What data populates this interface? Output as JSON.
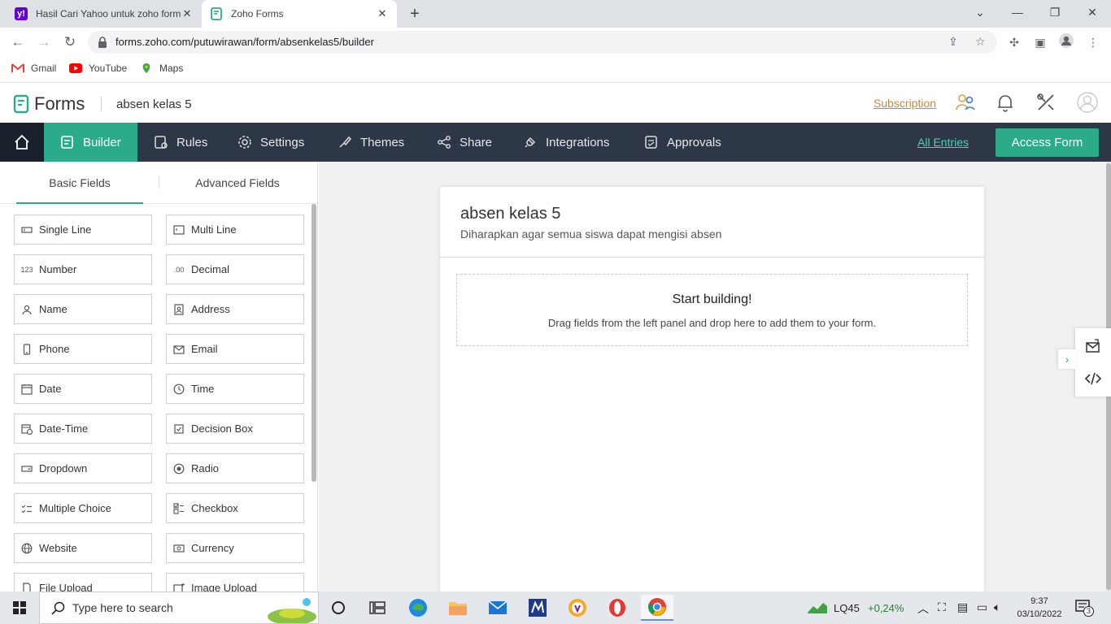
{
  "browser": {
    "tabs": [
      {
        "title": "Hasil Cari Yahoo untuk zoho form",
        "close": "✕"
      },
      {
        "title": "Zoho Forms",
        "close": "✕"
      }
    ],
    "new_tab": "+",
    "window_controls": {
      "minimize": "⌄",
      "restore": "—",
      "maximize": "❐",
      "close": "✕"
    },
    "url": "forms.zoho.com/putuwirawan/form/absenkelas5/builder",
    "bookmarks": [
      "Gmail",
      "YouTube",
      "Maps"
    ]
  },
  "header": {
    "app_name": "Forms",
    "form_title": "absen kelas 5",
    "subscription": "Subscription"
  },
  "nav": {
    "items": [
      "Builder",
      "Rules",
      "Settings",
      "Themes",
      "Share",
      "Integrations",
      "Approvals"
    ],
    "all_entries": "All Entries",
    "access_form": "Access Form"
  },
  "fields_panel": {
    "tabs": [
      "Basic Fields",
      "Advanced Fields"
    ],
    "fields": [
      {
        "label": "Single Line",
        "icon": "single-line-icon"
      },
      {
        "label": "Multi Line",
        "icon": "multi-line-icon"
      },
      {
        "label": "Number",
        "icon": "number-icon",
        "glyph": "123"
      },
      {
        "label": "Decimal",
        "icon": "decimal-icon",
        "glyph": ".00"
      },
      {
        "label": "Name",
        "icon": "person-icon"
      },
      {
        "label": "Address",
        "icon": "address-icon"
      },
      {
        "label": "Phone",
        "icon": "phone-icon"
      },
      {
        "label": "Email",
        "icon": "envelope-icon"
      },
      {
        "label": "Date",
        "icon": "calendar-icon"
      },
      {
        "label": "Time",
        "icon": "clock-icon"
      },
      {
        "label": "Date-Time",
        "icon": "date-time-icon"
      },
      {
        "label": "Decision Box",
        "icon": "decision-box-icon"
      },
      {
        "label": "Dropdown",
        "icon": "dropdown-icon"
      },
      {
        "label": "Radio",
        "icon": "radio-icon"
      },
      {
        "label": "Multiple Choice",
        "icon": "multiple-choice-icon"
      },
      {
        "label": "Checkbox",
        "icon": "checkbox-icon"
      },
      {
        "label": "Website",
        "icon": "globe-icon"
      },
      {
        "label": "Currency",
        "icon": "currency-icon"
      },
      {
        "label": "File Upload",
        "icon": "file-upload-icon"
      },
      {
        "label": "Image Upload",
        "icon": "image-upload-icon"
      }
    ]
  },
  "form": {
    "name": "absen kelas 5",
    "description": "Diharapkan agar semua siswa dapat mengisi absen",
    "dropzone_title": "Start building!",
    "dropzone_text": "Drag fields from the left panel and drop here to add them to your form."
  },
  "taskbar": {
    "search_placeholder": "Type here to search",
    "stock_name": "LQ45",
    "stock_change": "+0,24%",
    "time": "9:37",
    "date": "03/10/2022",
    "notifications": "3"
  },
  "colors": {
    "accent": "#2bab8a",
    "navbar": "#2d3748",
    "subscription": "#c58b3a"
  }
}
